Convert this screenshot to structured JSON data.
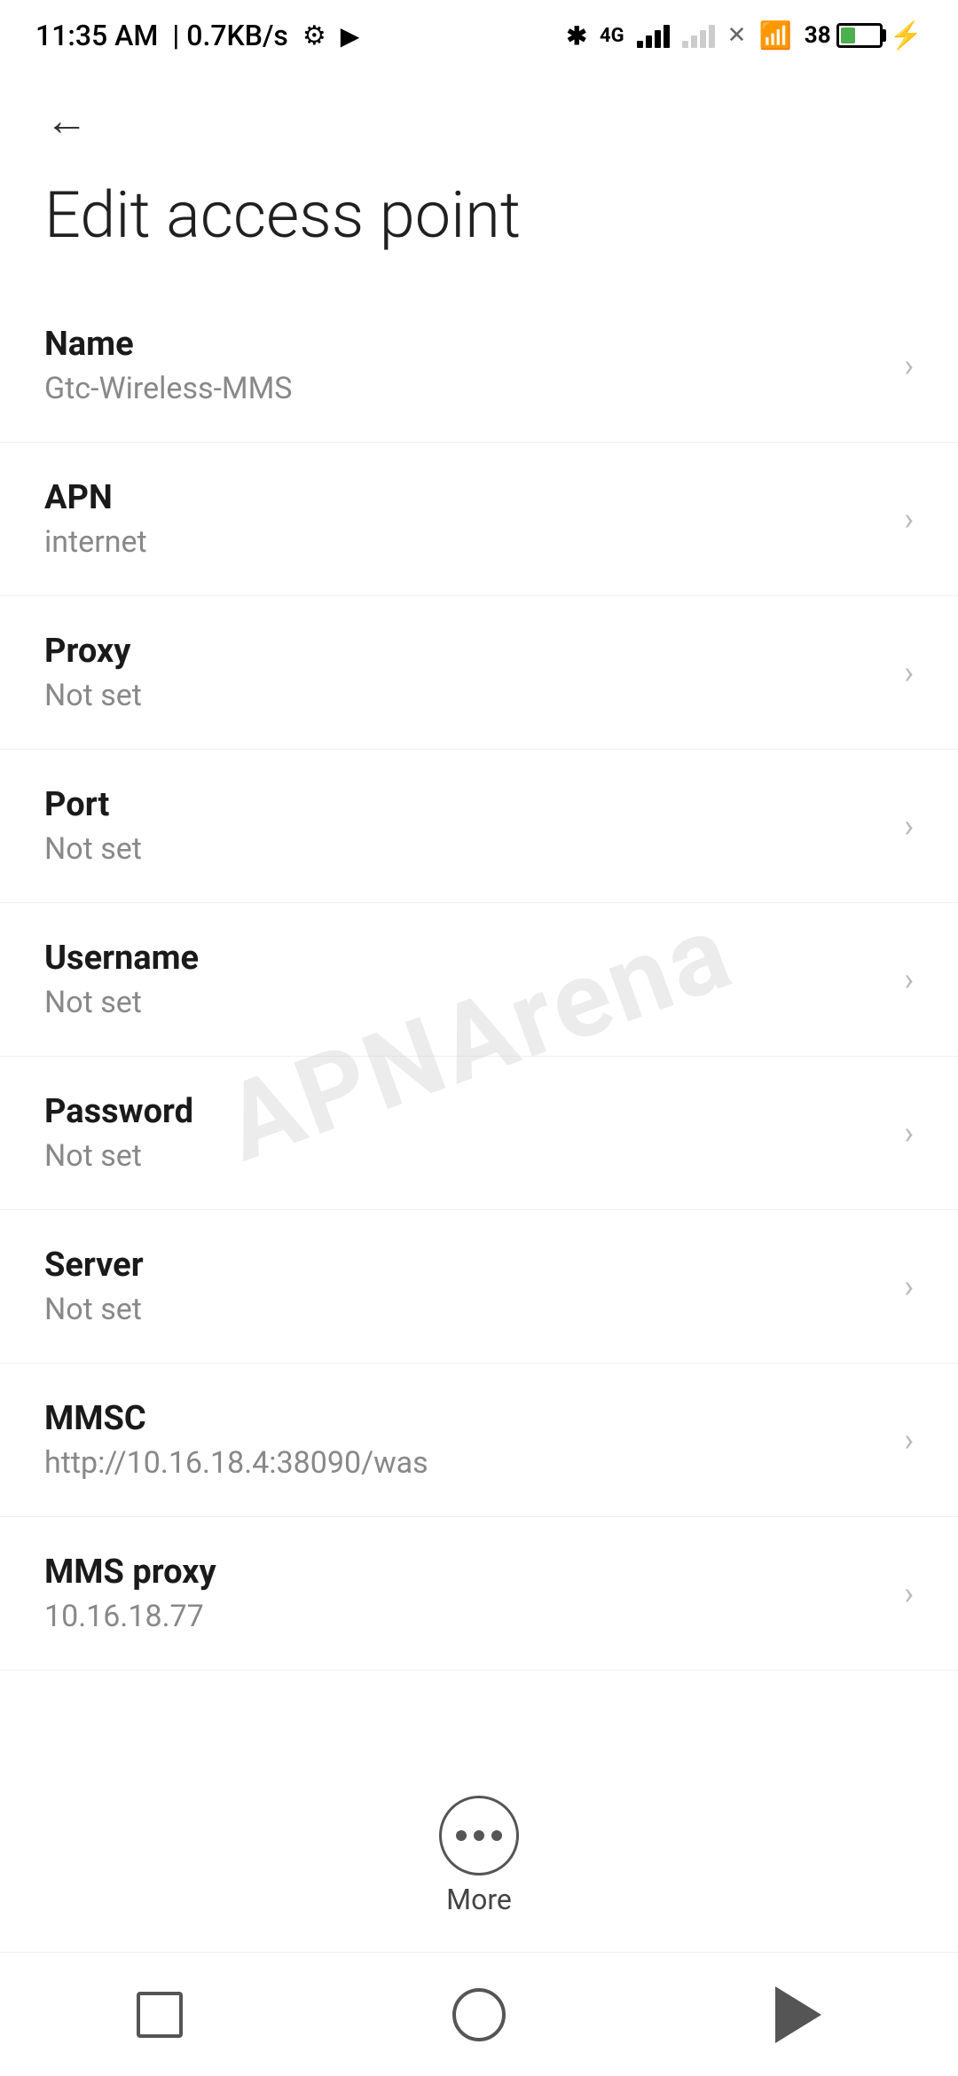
{
  "statusBar": {
    "time": "11:35 AM",
    "speed": "0.7KB/s"
  },
  "header": {
    "backLabel": "←"
  },
  "pageTitle": "Edit access point",
  "settings": [
    {
      "label": "Name",
      "value": "Gtc-Wireless-MMS"
    },
    {
      "label": "APN",
      "value": "internet"
    },
    {
      "label": "Proxy",
      "value": "Not set"
    },
    {
      "label": "Port",
      "value": "Not set"
    },
    {
      "label": "Username",
      "value": "Not set"
    },
    {
      "label": "Password",
      "value": "Not set"
    },
    {
      "label": "Server",
      "value": "Not set"
    },
    {
      "label": "MMSC",
      "value": "http://10.16.18.4:38090/was"
    },
    {
      "label": "MMS proxy",
      "value": "10.16.18.77"
    }
  ],
  "more": {
    "label": "More"
  },
  "watermark": "APNArena"
}
